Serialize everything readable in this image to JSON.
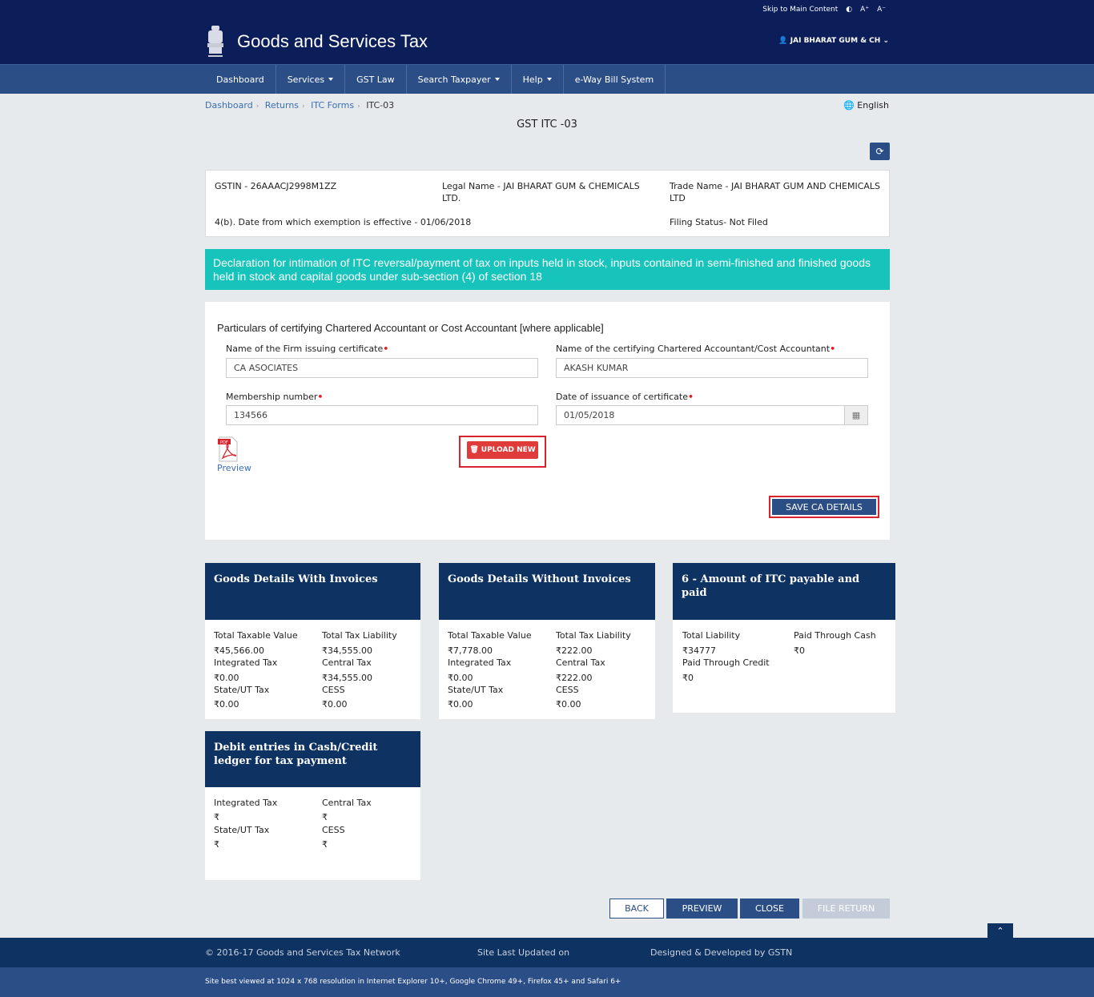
{
  "topbar": {
    "skip": "Skip to Main Content",
    "contrast_icon": "contrast-icon",
    "font_up": "A⁺",
    "font_down": "A⁻"
  },
  "header": {
    "title": "Goods and Services Tax",
    "user": "JAI BHARAT GUM & CH"
  },
  "nav": [
    {
      "label": "Dashboard",
      "dropdown": false
    },
    {
      "label": "Services",
      "dropdown": true
    },
    {
      "label": "GST Law",
      "dropdown": false
    },
    {
      "label": "Search Taxpayer",
      "dropdown": true
    },
    {
      "label": "Help",
      "dropdown": true
    },
    {
      "label": "e-Way Bill System",
      "dropdown": false
    }
  ],
  "breadcrumb": [
    "Dashboard",
    "Returns",
    "ITC Forms",
    "ITC-03"
  ],
  "language": "English",
  "page_title": "GST ITC -03",
  "info": {
    "gstin": "GSTIN - 26AAACJ2998M1ZZ",
    "legal_name_1": "Legal Name - JAI BHARAT GUM & CHEMICALS",
    "legal_name_2": "LTD.",
    "trade_name_1": "Trade Name - JAI BHARAT GUM AND CHEMICALS",
    "trade_name_2": "LTD",
    "exemption_date": "4(b). Date from which exemption is effective - 01/06/2018",
    "filing_status": "Filing Status- Not Filed"
  },
  "banner": "Declaration for intimation of ITC reversal/payment of tax on inputs held in stock, inputs contained in semi-finished and finished goods held in stock and capital goods under sub-section (4) of section 18",
  "ca": {
    "heading": "Particulars of certifying Chartered Accountant or Cost Accountant [where applicable]",
    "firm_label": "Name of the Firm issuing certificate",
    "firm_value": "CA ASOCIATES",
    "name_label": "Name of the certifying Chartered Accountant/Cost Accountant",
    "name_value": "AKASH KUMAR",
    "membership_label": "Membership number",
    "membership_value": "134566",
    "date_label": "Date of issuance of certificate",
    "date_value": "01/05/2018",
    "preview": "Preview",
    "upload": "UPLOAD NEW",
    "save": "SAVE CA DETAILS"
  },
  "cards": {
    "with_invoices": {
      "title": "Goods Details With Invoices",
      "l1": "Total Taxable Value",
      "v1": "₹45,566.00",
      "l2": "Total Tax Liability",
      "v2": "₹34,555.00",
      "l3": "Integrated Tax",
      "v3": "₹0.00",
      "l4": "Central Tax",
      "v4": "₹34,555.00",
      "l5": "State/UT Tax",
      "v5": "₹0.00",
      "l6": "CESS",
      "v6": "₹0.00"
    },
    "without_invoices": {
      "title": "Goods Details Without Invoices",
      "l1": "Total Taxable Value",
      "v1": "₹7,778.00",
      "l2": "Total Tax Liability",
      "v2": "₹222.00",
      "l3": "Integrated Tax",
      "v3": "₹0.00",
      "l4": "Central Tax",
      "v4": "₹222.00",
      "l5": "State/UT Tax",
      "v5": "₹0.00",
      "l6": "CESS",
      "v6": "₹0.00"
    },
    "itc_payable": {
      "title": "6 - Amount of ITC payable and paid",
      "l1": "Total Liability",
      "v1": "₹34777",
      "l2": "Paid Through Cash",
      "v2": "₹0",
      "l3": "Paid Through Credit",
      "v3": "₹0"
    },
    "debit_entries": {
      "title": "Debit entries in Cash/Credit ledger for tax payment",
      "l1": "Integrated Tax",
      "v1": "₹",
      "l2": "Central Tax",
      "v2": "₹",
      "l3": "State/UT Tax",
      "v3": "₹",
      "l4": "CESS",
      "v4": "₹"
    }
  },
  "actions": {
    "back": "BACK",
    "preview": "PREVIEW",
    "close": "CLOSE",
    "file": "FILE RETURN"
  },
  "footer": {
    "copyright": "© 2016-17 Goods and Services Tax Network",
    "updated": "Site Last Updated on",
    "designed": "Designed & Developed by GSTN",
    "best_viewed": "Site best viewed at 1024 x 768 resolution in Internet Explorer 10+, Google Chrome 49+, Firefox 45+ and Safari 6+"
  },
  "colors": {
    "header": "#0b1e59",
    "nav": "#2c4e86",
    "banner": "#17c4bb",
    "card_head": "#0e3261",
    "highlight": "#d9232e"
  }
}
